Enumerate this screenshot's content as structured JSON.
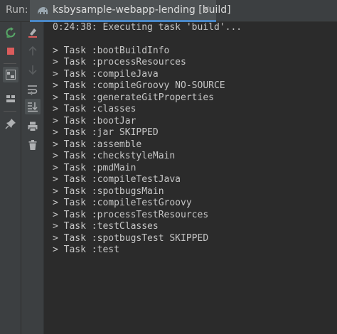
{
  "header": {
    "run_label": "Run:",
    "tab_title": "ksbysample-webapp-lending [build]",
    "tab_icon": "gradle-elephant-icon",
    "close_glyph": "×"
  },
  "colors": {
    "background": "#2b2b2b",
    "toolbar": "#3c3f41",
    "text": "#c6c6c6",
    "rerun_green": "#59a869",
    "stop_red": "#db5c5c",
    "tab_underline": "#4a88c7"
  },
  "toolbar_left": [
    {
      "name": "rerun-icon",
      "active": false
    },
    {
      "name": "stop-icon",
      "active": false
    },
    {
      "name": "toggle-tree-view-icon",
      "active": true
    },
    {
      "name": "layout-icon",
      "active": false
    },
    {
      "name": "pin-icon",
      "active": false
    }
  ],
  "toolbar_right": [
    {
      "name": "clear-all-icon",
      "active": false
    },
    {
      "name": "up-arrow-icon",
      "active": false
    },
    {
      "name": "down-arrow-icon",
      "active": false
    },
    {
      "name": "soft-wrap-icon",
      "active": false
    },
    {
      "name": "scroll-to-end-icon",
      "active": true
    },
    {
      "name": "print-icon",
      "active": false
    },
    {
      "name": "trash-icon",
      "active": false
    }
  ],
  "console": {
    "lines": [
      "0:24:38: Executing task 'build'...",
      "",
      "> Task :bootBuildInfo",
      "> Task :processResources",
      "> Task :compileJava",
      "> Task :compileGroovy NO-SOURCE",
      "> Task :generateGitProperties",
      "> Task :classes",
      "> Task :bootJar",
      "> Task :jar SKIPPED",
      "> Task :assemble",
      "> Task :checkstyleMain",
      "> Task :pmdMain",
      "> Task :compileTestJava",
      "> Task :spotbugsMain",
      "> Task :compileTestGroovy",
      "> Task :processTestResources",
      "> Task :testClasses",
      "> Task :spotbugsTest SKIPPED",
      "> Task :test"
    ]
  }
}
